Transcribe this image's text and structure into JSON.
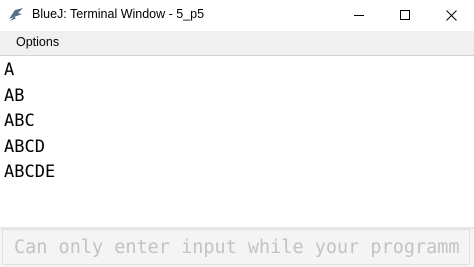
{
  "window": {
    "title": "BlueJ: Terminal Window - 5_p5",
    "icon": "bluej-bird-icon",
    "controls": [
      "minimize-icon",
      "maximize-icon",
      "close-icon"
    ]
  },
  "menubar": {
    "options_label": "Options"
  },
  "output": {
    "lines": [
      "A",
      "AB",
      "ABC",
      "ABCD",
      "ABCDE"
    ]
  },
  "input": {
    "placeholder": "Can only enter input while your programm"
  },
  "colors": {
    "menubar_bg": "#f0f0f0",
    "output_bg": "#ffffff",
    "input_bg": "#f4f4f4",
    "placeholder_text": "#c3c3c3"
  }
}
